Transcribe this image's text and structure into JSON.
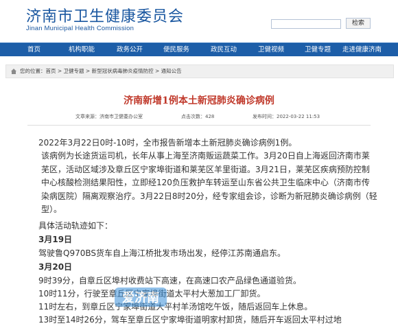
{
  "site": {
    "title_cn": "济南市卫生健康委员会",
    "title_en": "Jinan Municipal Health Commission",
    "search_button": "检索"
  },
  "nav": [
    "首页",
    "机构职能",
    "政务公开",
    "便民服务",
    "政民互动",
    "卫健视频",
    "卫健专题",
    "走进健康济南"
  ],
  "breadcrumb": "您的位置：首页 > 卫健专题 > 新型冠状病毒肺炎疫情防控 > 通知公告",
  "article": {
    "title": "济南新增1例本土新冠肺炎确诊病例",
    "source": "文章来源：济南市卫健委办公室",
    "views": "点击次数：428",
    "published": "发布时间：2022-03-22 11:53",
    "p1": "2022年3月22日0时-10时，全市报告新增本土新冠肺炎确诊病例1例。",
    "p2": "该病例为长途货运司机，长年从事上海至济南贩运蔬菜工作。3月20日自上海返回济南市莱芜区，活动区域涉及章丘区宁家埠街道和莱芜区羊里街道。3月21日，莱芜区疾病预防控制中心核酸检测结果阳性，立即经120负压救护车转运至山东省公共卫生临床中心（济南市传染病医院）隔离观察治疗。3月22日8时20分，经专家组会诊，诊断为新冠肺炎确诊病例（轻型）。",
    "p3": "具体活动轨迹如下：",
    "d1": "3月19日",
    "d1_text": "驾驶鲁Q970BS货车自上海江桥批发市场出发，经停江苏南通启东。",
    "d2": "3月20日",
    "d2_lines": [
      "9时39分，自章丘区埠村收费站下高速，在高速口农产品绿色通道验货。",
      "10时11分，行驶至章丘区宁家埠街道太平村大葱加工厂卸货。",
      "11时左右，到章丘区宁家埠街道大平村羊汤馆吃午饭，随后返回车上休息。",
      "13时至14时26分，驾车至章丘区宁家埠街道明家村卸货，随后开车返回太平村过地"
    ]
  },
  "watermark_text": "爱济南"
}
